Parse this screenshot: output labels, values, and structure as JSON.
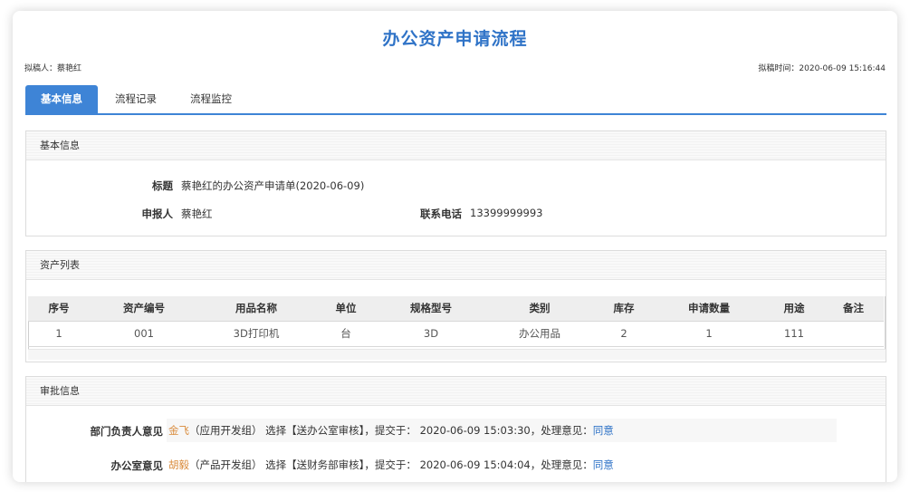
{
  "header": {
    "title": "办公资产申请流程",
    "drafter_label": "拟稿人：",
    "drafter": "蔡艳红",
    "draft_time_label": "拟稿时间：",
    "draft_time": "2020-06-09 15:16:44"
  },
  "tabs": [
    {
      "label": "基本信息",
      "active": true
    },
    {
      "label": "流程记录",
      "active": false
    },
    {
      "label": "流程监控",
      "active": false
    }
  ],
  "basic": {
    "section_title": "基本信息",
    "title_label": "标题",
    "title_value": "蔡艳红的办公资产申请单(2020-06-09)",
    "applicant_label": "申报人",
    "applicant_value": "蔡艳红",
    "phone_label": "联系电话",
    "phone_value": "13399999993"
  },
  "assets": {
    "section_title": "资产列表",
    "columns": [
      "序号",
      "资产编号",
      "用品名称",
      "单位",
      "规格型号",
      "类别",
      "库存",
      "申请数量",
      "用途",
      "备注"
    ],
    "rows": [
      [
        "1",
        "001",
        "3D打印机",
        "台",
        "3D",
        "办公用品",
        "2",
        "1",
        "111",
        ""
      ]
    ]
  },
  "approval": {
    "section_title": "审批信息",
    "entries": [
      {
        "label": "部门负责人意见",
        "person": "金飞",
        "dept": "（应用开发组）",
        "action": "选择【送办公室审核】，提交于：",
        "time": "2020-06-09 15:03:30",
        "opinion_label": "，处理意见：",
        "opinion": "同意"
      },
      {
        "label": "办公室意见",
        "person": "胡毅",
        "dept": "（产品开发组）",
        "action": "选择【送财务部审核】，提交于：",
        "time": "2020-06-09 15:04:04",
        "opinion_label": "，处理意见：",
        "opinion": "同意"
      }
    ]
  },
  "colors": {
    "accent": "#3e84d6",
    "title": "#2f73c7",
    "person": "#d98a3a"
  }
}
